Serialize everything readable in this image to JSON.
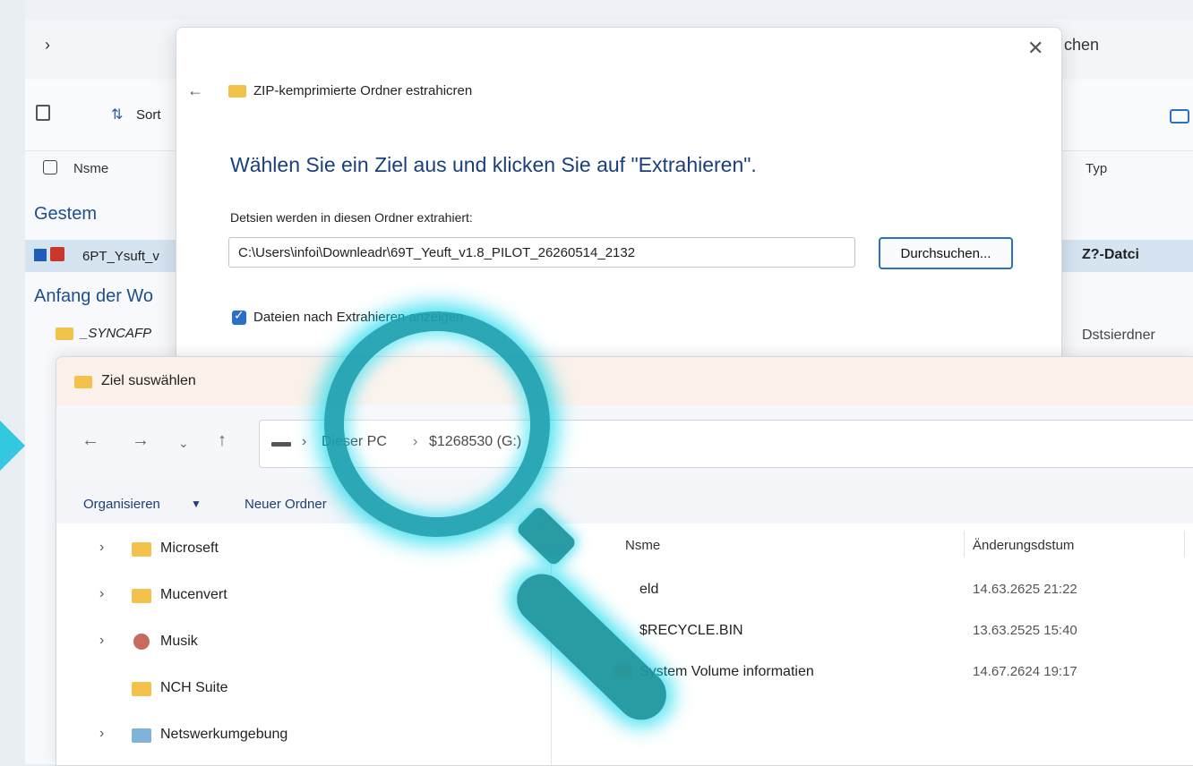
{
  "background_window": {
    "search_label": "chen",
    "toolbar": {
      "sort_label": "Sort"
    },
    "columns": {
      "name": "Nsme",
      "type": "Typ"
    },
    "groups": [
      "Gestem",
      "Anfang der Wo"
    ],
    "rows": [
      {
        "name": "6PT_Ysuft_v",
        "type": "Z?-Datci"
      },
      {
        "name": "_SYNCAFP",
        "type": "Dstsierdner"
      }
    ]
  },
  "extract_dialog": {
    "title": "ZIP-kemprimierte Ordner estrahicren",
    "heading": "Wählen Sie ein Ziel aus und klicken Sie auf \"Extrahieren\".",
    "path_label": "Detsien werden in diesen Ordner extrahiert:",
    "path_value": "C:\\Users\\infoi\\Downleadr\\69T_Yeuft_v1.8_PILOT_26260514_2132",
    "browse_label": "Durchsuchen...",
    "checkbox_label": "Dateien nach Extrahieren anzeigen",
    "checkbox_checked": true
  },
  "dest_dialog": {
    "title": "Ziel suswählen",
    "breadcrumb": [
      "Dieser PC",
      "$1268530 (G:)"
    ],
    "commands": {
      "organize": "Organisieren",
      "new_folder": "Neuer Ordner"
    },
    "tree": [
      {
        "label": "Microseft",
        "icon": "folder-icon",
        "expandable": true
      },
      {
        "label": "Mucenvert",
        "icon": "folder-icon",
        "expandable": true
      },
      {
        "label": "Musik",
        "icon": "music-icon",
        "expandable": true
      },
      {
        "label": "NCH Suite",
        "icon": "folder-icon",
        "expandable": false
      },
      {
        "label": "Netswerkumgebung",
        "icon": "network-icon",
        "expandable": true
      }
    ],
    "columns": {
      "name": "Nsme",
      "date": "Änderungsdstum"
    },
    "files": [
      {
        "name": "eld",
        "date": "14.63.2625 21:22"
      },
      {
        "name": "$RECYCLE.BIN",
        "date": "13.63.2525 15:40"
      },
      {
        "name": "System Volume informatien",
        "date": "14.67.2624 19:17"
      }
    ]
  },
  "overlay": {
    "accent_color": "#00d7eb",
    "icon": "magnifier-icon"
  }
}
